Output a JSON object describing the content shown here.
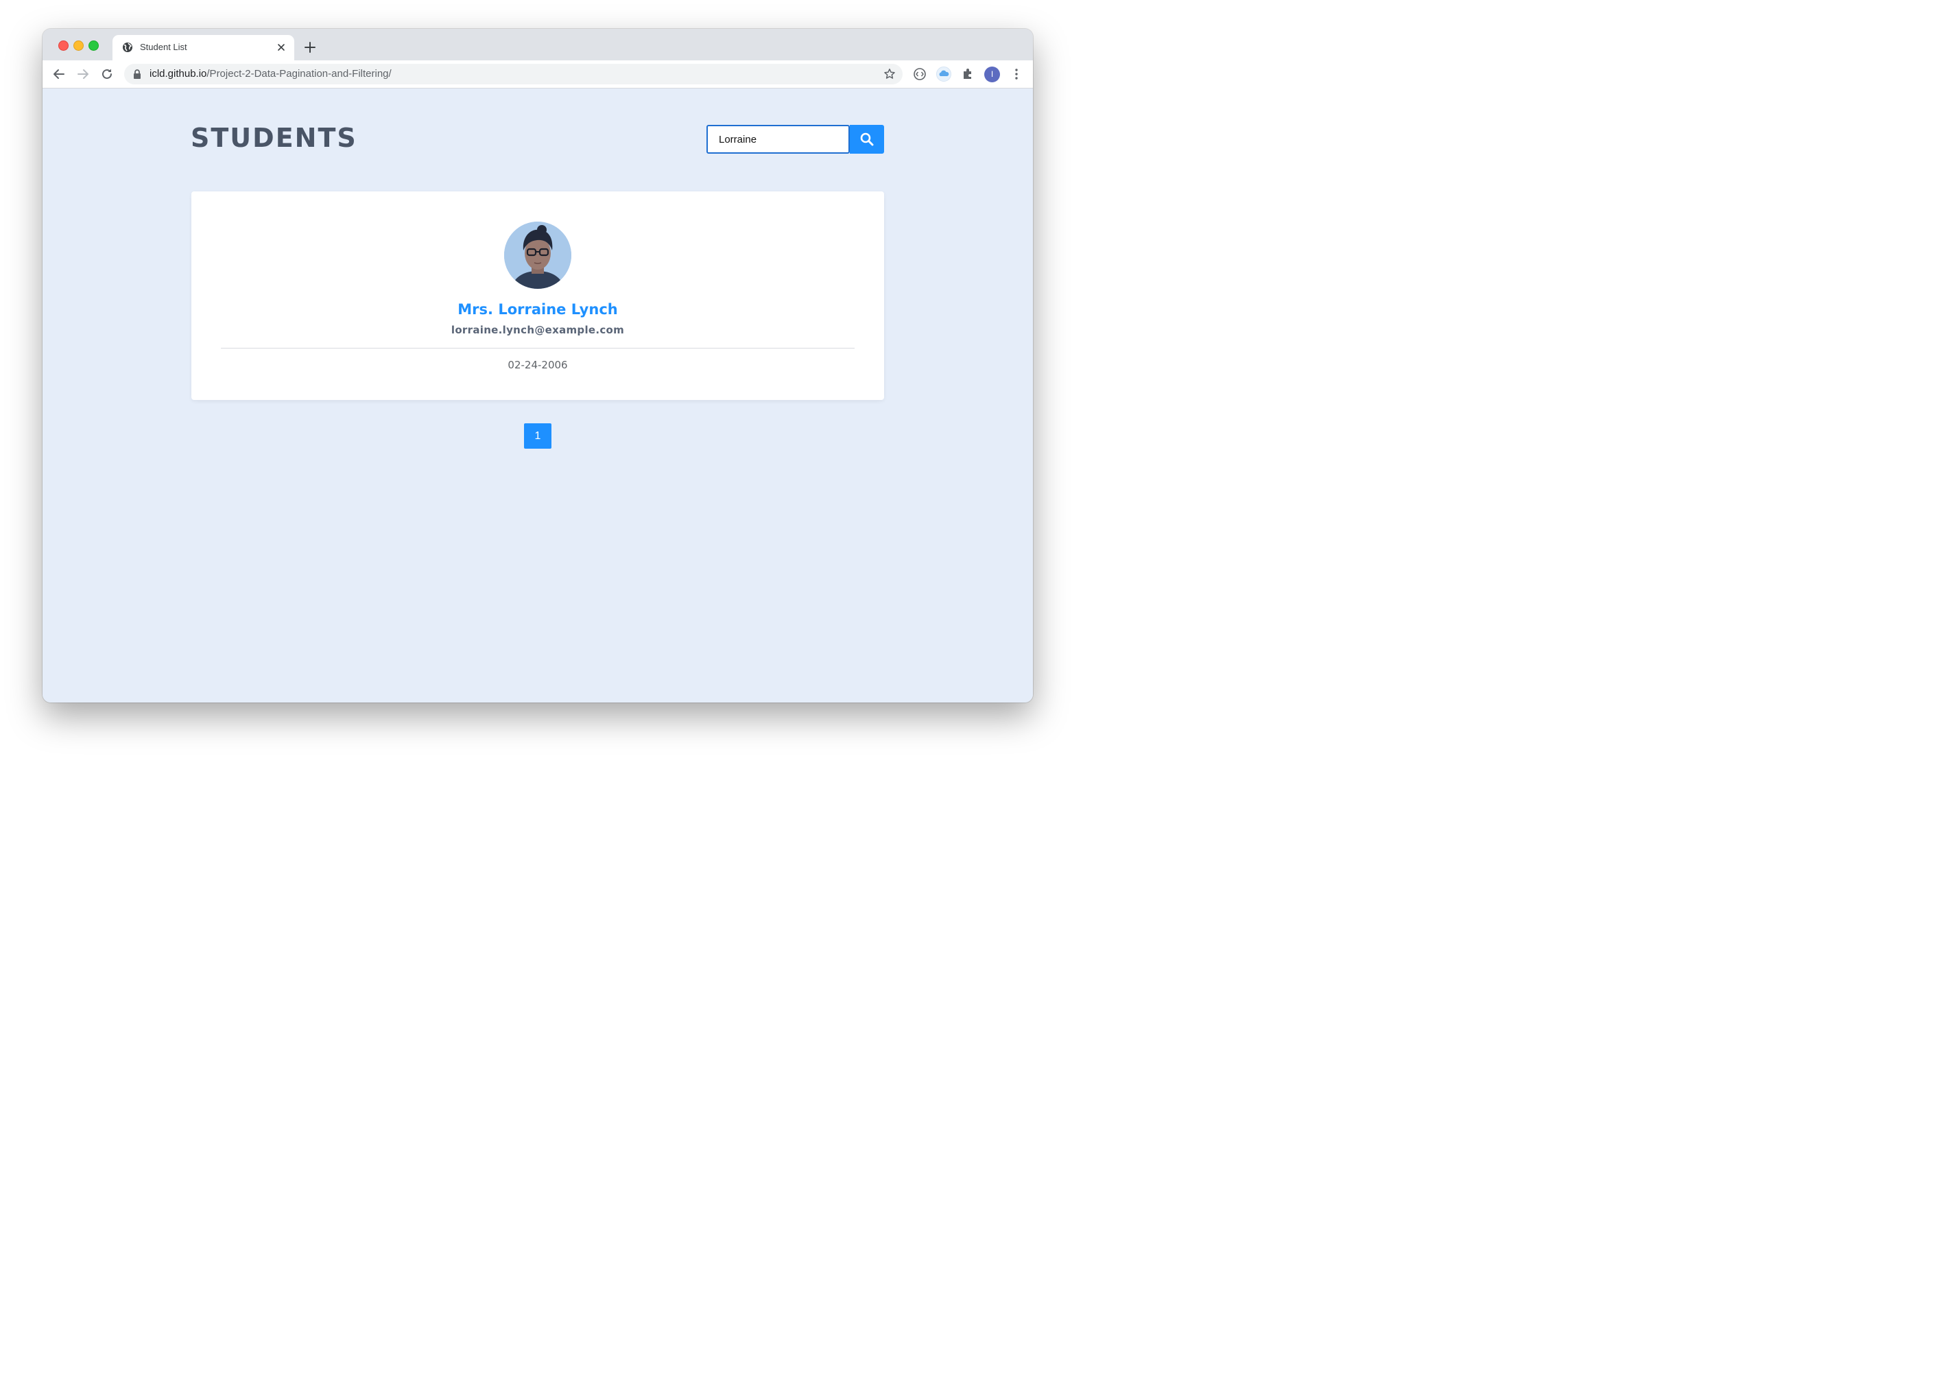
{
  "browser": {
    "tab": {
      "title": "Student List"
    },
    "address_bar": {
      "host": "icld.github.io",
      "path": "/Project-2-Data-Pagination-and-Filtering/"
    },
    "profile_initial": "I",
    "icons": {
      "favicon": "globe-icon",
      "tab_close": "close-icon",
      "new_tab": "plus-icon",
      "back": "arrow-left-icon",
      "forward": "arrow-right-icon",
      "reload": "reload-icon",
      "lock": "lock-icon",
      "bookmark": "star-icon",
      "extension_1": "code-circle-icon",
      "extension_2": "cloud-icon",
      "extensions": "puzzle-icon",
      "menu": "kebab-menu-icon"
    }
  },
  "page": {
    "title": "STUDENTS",
    "search": {
      "value": "Lorraine",
      "button_icon": "search-icon"
    },
    "students": [
      {
        "name": "Mrs. Lorraine Lynch",
        "email": "lorraine.lynch@example.com",
        "joined": "02-24-2006"
      }
    ],
    "pagination": {
      "pages": [
        "1"
      ],
      "active": "1"
    },
    "colors": {
      "background": "#e5edf9",
      "accent": "#1e90ff",
      "title": "#4a5567"
    }
  }
}
